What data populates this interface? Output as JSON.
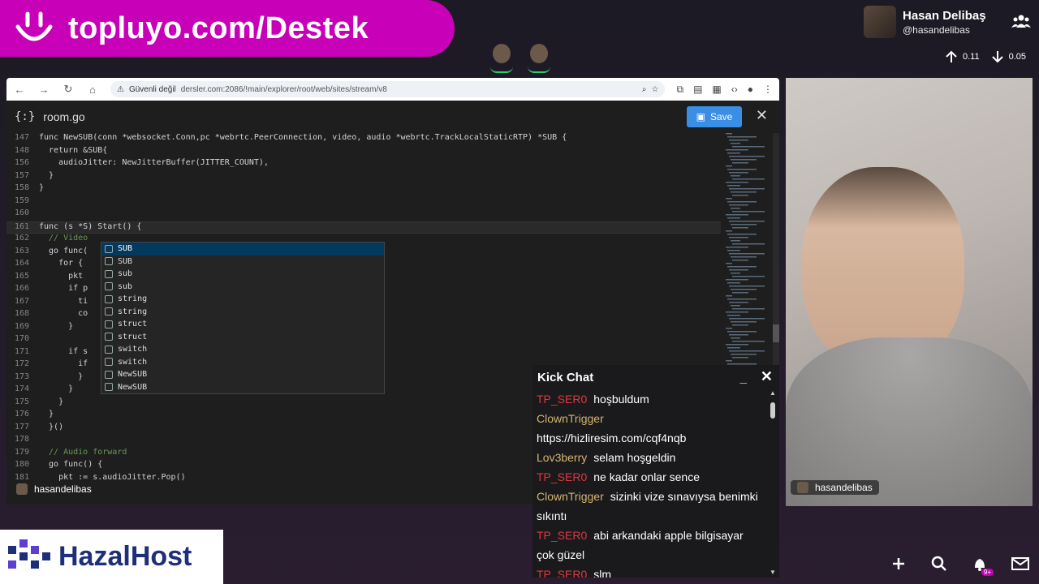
{
  "banner": {
    "text": "topluyo.com/Destek"
  },
  "profile": {
    "name": "Hasan Delibaş",
    "handle": "@hasandelibas"
  },
  "net": {
    "up": "0.11",
    "down": "0.05"
  },
  "browser": {
    "secure_label": "Güvenli değil",
    "url": "dersler.com:2086/!main/explorer/root/web/sites/stream/v8"
  },
  "editor": {
    "file": "room.go",
    "save_label": "Save",
    "lines": [
      {
        "n": "147",
        "t": "func NewSUB(conn *websocket.Conn,pc *webrtc.PeerConnection, video, audio *webrtc.TrackLocalStaticRTP) *SUB {"
      },
      {
        "n": "148",
        "t": "  return &SUB{"
      },
      {
        "n": "156",
        "t": "    audioJitter: NewJitterBuffer(JITTER_COUNT),"
      },
      {
        "n": "157",
        "t": "  }"
      },
      {
        "n": "158",
        "t": "}"
      },
      {
        "n": "159",
        "t": ""
      },
      {
        "n": "160",
        "t": ""
      },
      {
        "n": "161",
        "t": "func (s *S) Start() {"
      },
      {
        "n": "162",
        "t": "  // Video"
      },
      {
        "n": "163",
        "t": "  go func("
      },
      {
        "n": "164",
        "t": "    for {"
      },
      {
        "n": "165",
        "t": "      pkt"
      },
      {
        "n": "166",
        "t": "      if p"
      },
      {
        "n": "167",
        "t": "        ti"
      },
      {
        "n": "168",
        "t": "        co"
      },
      {
        "n": "169",
        "t": "      }"
      },
      {
        "n": "170",
        "t": ""
      },
      {
        "n": "171",
        "t": "      if s"
      },
      {
        "n": "172",
        "t": "        if"
      },
      {
        "n": "173",
        "t": "        }"
      },
      {
        "n": "174",
        "t": "      }"
      },
      {
        "n": "175",
        "t": "    }"
      },
      {
        "n": "176",
        "t": "  }"
      },
      {
        "n": "177",
        "t": "  }()"
      },
      {
        "n": "178",
        "t": ""
      },
      {
        "n": "179",
        "t": "  // Audio forward"
      },
      {
        "n": "180",
        "t": "  go func() {"
      },
      {
        "n": "181",
        "t": "    pkt := s.audioJitter.Pop()"
      }
    ],
    "suggestions": [
      "SUB",
      "SUB",
      "sub",
      "sub",
      "string",
      "string",
      "struct",
      "struct",
      "switch",
      "switch",
      "NewSUB",
      "NewSUB"
    ]
  },
  "cam_user": "hasandelibas",
  "chat": {
    "title": "Kick Chat",
    "messages": [
      {
        "user": "TP_SER0",
        "color": "red",
        "text": "hoşbuldum"
      },
      {
        "user": "ClownTrigger",
        "color": "gold",
        "text": ""
      },
      {
        "user": "",
        "color": "",
        "text": "https://hizliresim.com/cqf4nqb"
      },
      {
        "user": "Lov3berry",
        "color": "gold",
        "text": "selam hoşgeldin"
      },
      {
        "user": "TP_SER0",
        "color": "red",
        "text": "ne kadar onlar sence"
      },
      {
        "user": "ClownTrigger",
        "color": "gold",
        "text": "sizinki vize sınavıysa benimki sıkıntı"
      },
      {
        "user": "TP_SER0",
        "color": "red",
        "text": "abi arkandaki apple bilgisayar çok güzel"
      },
      {
        "user": "TP_SER0",
        "color": "red",
        "text": "slm"
      }
    ]
  },
  "sponsor": {
    "name": "HazalHost"
  },
  "notifications": {
    "badge": "9+"
  }
}
